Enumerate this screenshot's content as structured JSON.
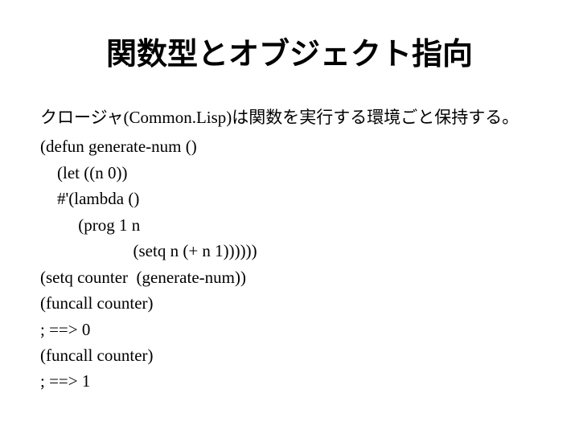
{
  "title": "関数型とオブジェクト指向",
  "lead": "クロージャ(Common.Lisp)は関数を実行する環境ごと保持する。",
  "code": {
    "l1": "(defun generate-num ()",
    "l2": "    (let ((n 0))",
    "l3": "    #'(lambda ()",
    "l4": "         (prog 1 n",
    "l5": "                      (setq n (+ n 1))))))",
    "l6": "(setq counter  (generate-num))",
    "l7": "(funcall counter)",
    "l8": "; ==> 0",
    "l9": "(funcall counter)",
    "l10": "; ==> 1"
  }
}
